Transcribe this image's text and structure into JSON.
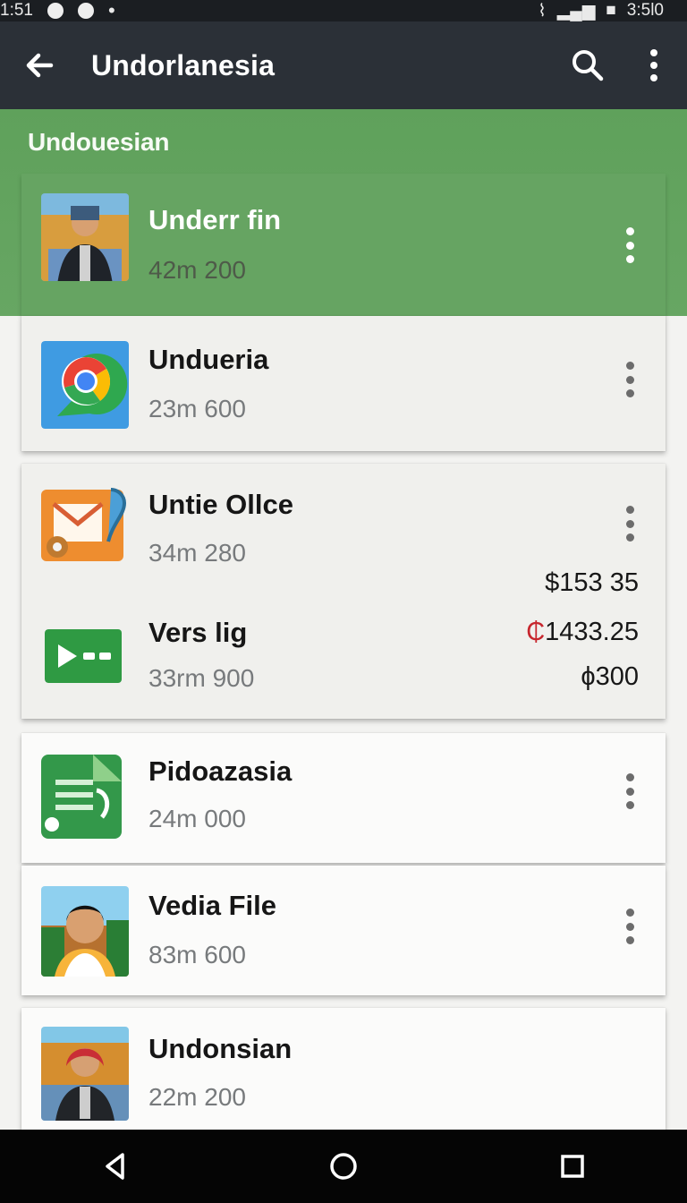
{
  "status_bar": {
    "time": "1:51",
    "right_time": "3:5l0"
  },
  "toolbar": {
    "title": "Undorlanesia",
    "back_icon": "arrow-left-icon",
    "search_icon": "search-icon",
    "more_icon": "more-vert-icon"
  },
  "section": {
    "label": "Undouesian"
  },
  "items": [
    {
      "title": "Underr fin",
      "subtitle": "42m 200",
      "icon": "person-photo"
    },
    {
      "title": "Undueria",
      "subtitle": "23m 600",
      "icon": "chrome-icon"
    },
    {
      "title": "Untie Ollce",
      "subtitle": "34m 280",
      "icon": "mail-settings-icon"
    },
    {
      "title": "Vers lig",
      "subtitle": "33rm 900",
      "icon": "video-icon"
    },
    {
      "title": "Pidoazasia",
      "subtitle": "24m 000",
      "icon": "document-icon"
    },
    {
      "title": "Vedia File",
      "subtitle": "83m 600",
      "icon": "person-photo"
    },
    {
      "title": "Undonsian",
      "subtitle": "22m 200",
      "icon": "person-photo"
    }
  ],
  "amounts": {
    "first": "$153 35",
    "second_prefix": "₵",
    "second_value": "1433.25",
    "third": "ϕ300"
  },
  "colors": {
    "toolbar": "#2b3037",
    "green": "#66a462",
    "accent_red": "#c7262d",
    "chrome_blue": "#42a5f5"
  }
}
